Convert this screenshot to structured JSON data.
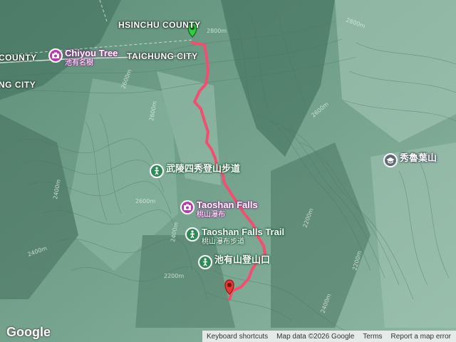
{
  "map": {
    "admin_labels": {
      "hsinchu": "HSINCHU COUNTY",
      "taichung": "TAICHUNG CITY",
      "county_left": "COUNTY",
      "city_left": "NG CITY"
    },
    "contour_labels": [
      "2800m",
      "2800m",
      "2600m",
      "2600m",
      "2600m",
      "2600m",
      "2400m",
      "2400m",
      "2400m",
      "2200m",
      "2200m",
      "2200m",
      "2400m"
    ],
    "pois": {
      "chiyou": {
        "name": "Chiyou Tree",
        "sub": "池有名樹",
        "icon": "camera-icon"
      },
      "wuling": {
        "name": "武陵四秀登山步道",
        "icon": "hiker-icon"
      },
      "taoshan_falls": {
        "name": "Taoshan Falls",
        "sub": "桃山瀑布",
        "icon": "camera-icon"
      },
      "taoshan_trail": {
        "name": "Taoshan Falls Trail",
        "sub": "桃山瀑布步道",
        "icon": "hiker-icon"
      },
      "chiyou_trailhead": {
        "name": "池有山登山口",
        "icon": "hiker-icon"
      },
      "xiuluye": {
        "name": "秀魯葉山",
        "icon": "school-icon"
      }
    },
    "colors": {
      "route": "#f0506e",
      "start_marker": "#2ecc40",
      "end_marker": "#e53935"
    }
  },
  "footer": {
    "logo": "Google",
    "keyboard": "Keyboard shortcuts",
    "map_data": "Map data ©2026 Google",
    "terms": "Terms",
    "report": "Report a map error"
  }
}
